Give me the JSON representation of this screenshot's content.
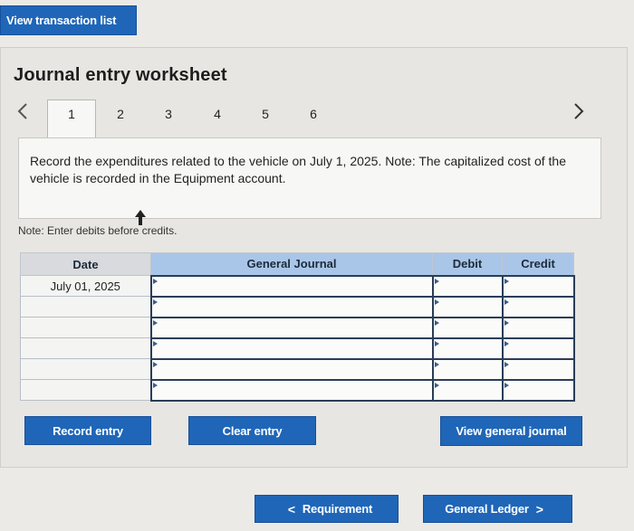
{
  "top_button": {
    "label": "View transaction list"
  },
  "worksheet": {
    "title": "Journal entry worksheet",
    "tabs": [
      "1",
      "2",
      "3",
      "4",
      "5",
      "6"
    ],
    "active_tab": "1",
    "prev_icon": "chevron-left-icon",
    "next_icon": "chevron-right-icon",
    "instruction": "Record the expenditures related to the vehicle on July 1, 2025. Note: The capitalized cost of the vehicle is recorded in the Equipment account.",
    "note": "Note: Enter debits before credits."
  },
  "table": {
    "headers": {
      "date": "Date",
      "journal": "General Journal",
      "debit": "Debit",
      "credit": "Credit"
    },
    "rows": [
      {
        "date": "July 01, 2025",
        "account": "",
        "debit": "",
        "credit": ""
      },
      {
        "date": "",
        "account": "",
        "debit": "",
        "credit": ""
      },
      {
        "date": "",
        "account": "",
        "debit": "",
        "credit": ""
      },
      {
        "date": "",
        "account": "",
        "debit": "",
        "credit": ""
      },
      {
        "date": "",
        "account": "",
        "debit": "",
        "credit": ""
      },
      {
        "date": "",
        "account": "",
        "debit": "",
        "credit": ""
      }
    ]
  },
  "buttons": {
    "record_entry": "Record entry",
    "clear_entry": "Clear entry",
    "view_general_journal": "View general journal"
  },
  "nav": {
    "requirement": "Requirement",
    "general_ledger": "General Ledger",
    "prev_symbol": "<",
    "next_symbol": ">"
  },
  "colors": {
    "button": "#1f66b8",
    "header": "#a9c6e8"
  }
}
